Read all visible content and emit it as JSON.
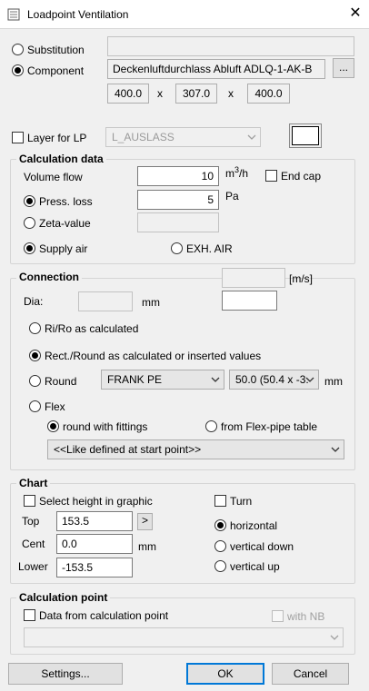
{
  "window": {
    "title": "Loadpoint Ventilation",
    "close_icon": "close-icon",
    "app_icon": "ventilation-app-icon"
  },
  "top": {
    "substitution_label": "Substitution",
    "substitution_value": "",
    "component_label": "Component",
    "component_value": "Deckenluftdurchlass Abluft ADLQ-1-AK-B",
    "browse_label": "...",
    "dims": [
      "400.0",
      "307.0",
      "400.0"
    ],
    "dim_sep": "x",
    "layer_label": "Layer for LP",
    "layer_value": "L_AUSLASS",
    "swatch_color": "#ffffff"
  },
  "calc": {
    "title": "Calculation data",
    "volume_flow_label": "Volume flow",
    "volume_flow_value": "10",
    "volume_flow_unit_base": "m",
    "volume_flow_unit_exp": "3",
    "volume_flow_unit_tail": "/h",
    "end_cap_label": "End cap",
    "press_loss_label": "Press. loss",
    "press_loss_value": "5",
    "press_loss_unit": "Pa",
    "zeta_label": "Zeta-value",
    "zeta_value": "",
    "supply_air_label": "Supply air",
    "exh_air_label": "EXH. AIR"
  },
  "connection": {
    "title": "Connection",
    "velocity_value": "",
    "velocity_unit": "[m/s]",
    "velocity_input": "",
    "dia_label": "Dia:",
    "dia_value": "",
    "dia_unit": "mm",
    "ri_ro_label": "Ri/Ro as calculated",
    "rect_round_label": "Rect./Round as calculated or inserted values",
    "round_label": "Round",
    "round_material": "FRANK PE",
    "round_size": "50.0 (50.4 x -3.",
    "round_unit": "mm",
    "flex_label": "Flex",
    "round_fittings_label": "round with fittings",
    "flex_table_label": "from Flex-pipe table",
    "flex_option": "<<Like defined at start point>>"
  },
  "chart": {
    "title": "Chart",
    "select_height_label": "Select height in graphic",
    "turn_label": "Turn",
    "top_label": "Top",
    "top_value": "153.5",
    "arrow_label": ">",
    "cent_label": "Cent",
    "cent_value": "0.0",
    "cent_unit": "mm",
    "lower_label": "Lower",
    "lower_value": "-153.5",
    "horizontal_label": "horizontal",
    "vertical_down_label": "vertical down",
    "vertical_up_label": "vertical up"
  },
  "calcpoint": {
    "title": "Calculation point",
    "data_from_label": "Data from calculation point",
    "with_nb_label": "with NB",
    "select_value": ""
  },
  "buttons": {
    "settings": "Settings...",
    "ok": "OK",
    "cancel": "Cancel"
  }
}
